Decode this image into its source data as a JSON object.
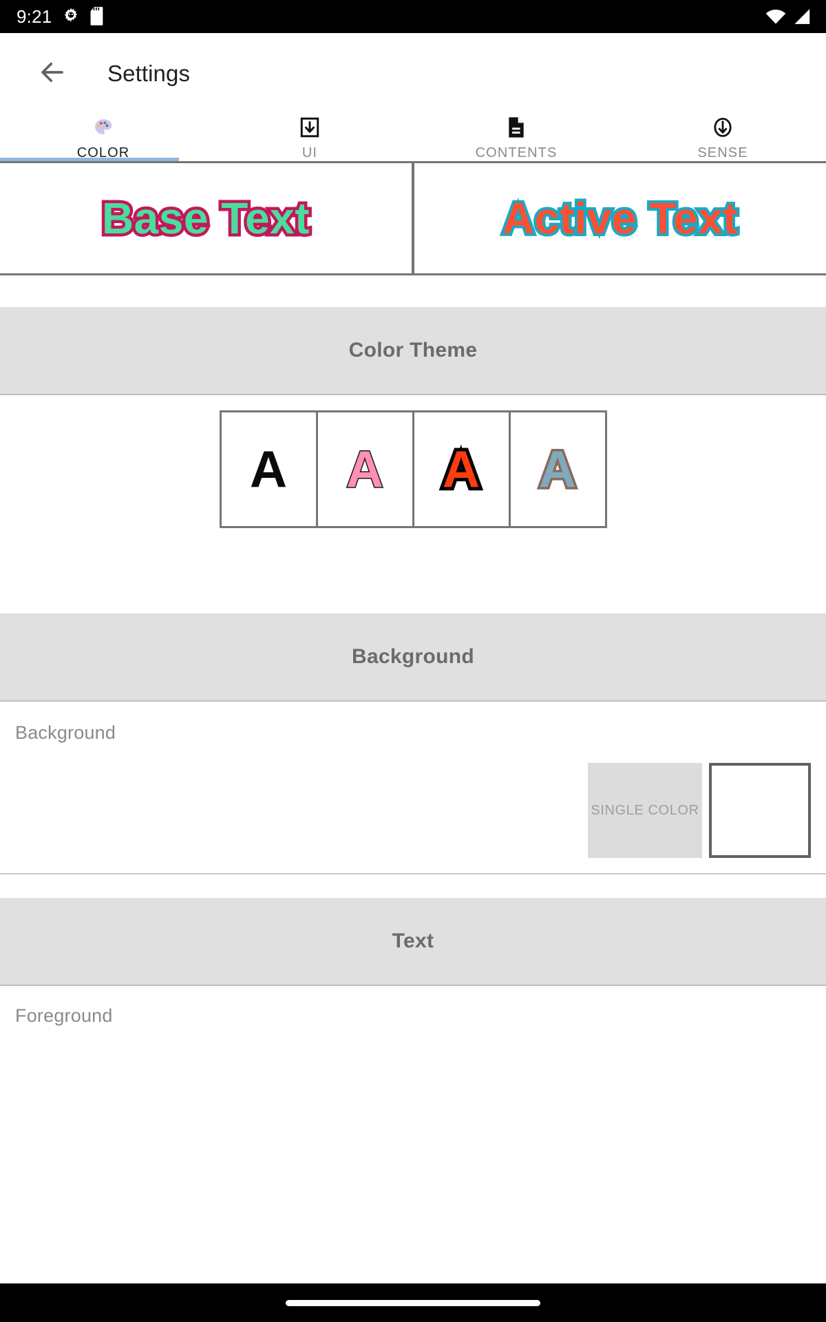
{
  "status_bar": {
    "clock": "9:21",
    "left_icons": [
      "android-gear-icon",
      "sd-card-icon"
    ],
    "right_icons": [
      "wifi-icon",
      "cellular-signal-icon"
    ],
    "background": "#000000",
    "foreground": "#ffffff"
  },
  "toolbar": {
    "back_icon": "back-arrow-icon",
    "title": "Settings"
  },
  "tabs": {
    "indicator_color": "#8fb9dd",
    "active_index": 0,
    "items": [
      {
        "label": "COLOR",
        "icon": "palette-icon",
        "glyph": "🎨",
        "active": true
      },
      {
        "label": "UI",
        "icon": "box-download-icon",
        "glyph": "",
        "active": false
      },
      {
        "label": "CONTENTS",
        "icon": "document-icon",
        "glyph": "",
        "active": false
      },
      {
        "label": "SENSE",
        "icon": "circle-down-arrow-icon",
        "glyph": "",
        "active": false
      }
    ]
  },
  "preview": {
    "base": {
      "text": "Base Text",
      "fill": "#4ade9e",
      "stroke": "#c2185b"
    },
    "active": {
      "text": "Active Text",
      "fill": "#ff4f32",
      "stroke": "#1ba9c4"
    }
  },
  "sections": {
    "color_theme": {
      "title": "Color Theme",
      "swatches": [
        {
          "letter": "A",
          "fill": "#0b0b0b",
          "stroke": "#0b0b0b",
          "stroke_width": "0px",
          "name": "theme-swatch-black"
        },
        {
          "letter": "A",
          "fill": "#ff8fb3",
          "stroke": "#1a1a1a",
          "stroke_width": "3px",
          "name": "theme-swatch-pink"
        },
        {
          "letter": "A",
          "fill": "#ff3c10",
          "stroke": "#000000",
          "stroke_width": "10px",
          "name": "theme-swatch-orange"
        },
        {
          "letter": "A",
          "fill": "#7fabbd",
          "stroke": "#8a6a5c",
          "stroke_width": "7px",
          "name": "theme-swatch-steelblue"
        }
      ]
    },
    "background": {
      "title": "Background",
      "row_label": "Background",
      "single_color_label": "SINGLE COLOR",
      "color_value": "#ffffff"
    },
    "text": {
      "title": "Text",
      "row_label": "Foreground"
    }
  },
  "nav_bar": {
    "gesture_pill": "home-gesture-pill"
  }
}
